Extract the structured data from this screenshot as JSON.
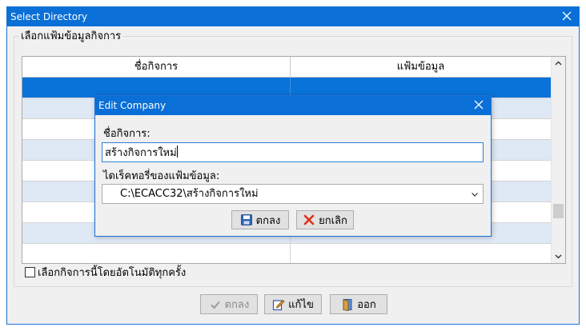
{
  "window": {
    "title": "Select Directory"
  },
  "group": {
    "label": "เลือกแฟ้มข้อมูลกิจการ"
  },
  "grid": {
    "columns": [
      "ชื่อกิจการ",
      "แฟ้มข้อมูล"
    ],
    "rows": [
      {
        "name": "",
        "folder": "",
        "state": "selected"
      },
      {
        "name": "",
        "folder": "",
        "state": "alt"
      },
      {
        "name": "",
        "folder": "",
        "state": "normal"
      },
      {
        "name": "",
        "folder": "",
        "state": "alt"
      },
      {
        "name": "",
        "folder": "",
        "state": "normal"
      },
      {
        "name": "",
        "folder": "",
        "state": "alt"
      },
      {
        "name": "",
        "folder": "",
        "state": "normal"
      },
      {
        "name": "",
        "folder": "",
        "state": "alt"
      },
      {
        "name": "",
        "folder": "",
        "state": "normal"
      }
    ]
  },
  "auto_select": {
    "label": "เลือกกิจการนี้โดยอัตโนมัติทุกครั้ง",
    "checked": false
  },
  "buttons": {
    "ok": "ตกลง",
    "edit": "แก้ไข",
    "exit": "ออก"
  },
  "modal": {
    "title": "Edit Company",
    "name_label": "ชื่อกิจการ:",
    "name_value": "สร้างกิจการใหม่",
    "dir_label": "ไดเร็คทอรี่ของแฟ้มข้อมูล:",
    "dir_value": "C:\\ECACC32\\สร้างกิจการใหม่",
    "ok_label": "ตกลง",
    "cancel_label": "ยกเลิก"
  },
  "colors": {
    "titlebar": "#0a6fd6",
    "selection": "#0a73d9",
    "alt_row": "#dfe8f5",
    "cancel_x": "#e0311c"
  },
  "icons": {
    "close": "close-icon",
    "ok": "checkmark-icon",
    "edit": "pencil-icon",
    "exit": "door-exit-icon",
    "save": "floppy-disk-icon",
    "cancel": "red-x-icon"
  }
}
